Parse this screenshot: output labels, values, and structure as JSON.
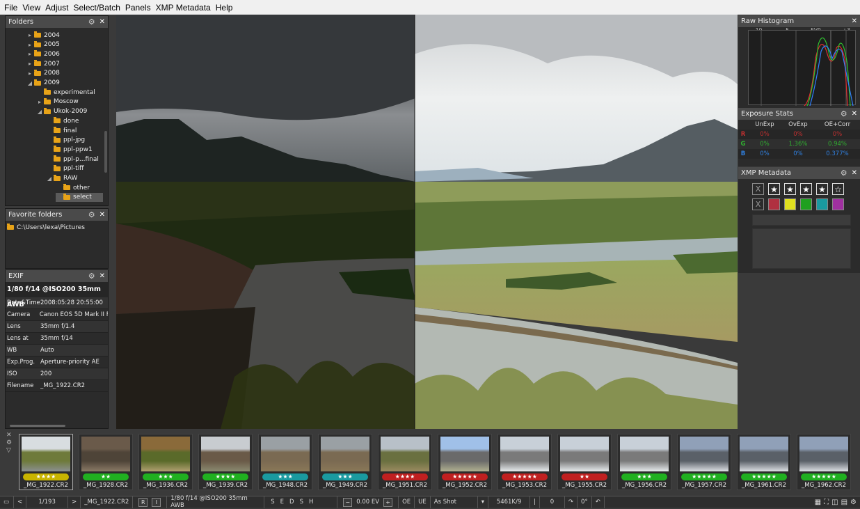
{
  "menu": [
    "File",
    "View",
    "Adjust",
    "Select/Batch",
    "Panels",
    "XMP Metadata",
    "Help"
  ],
  "folders": {
    "title": "Folders",
    "items": [
      {
        "label": "2004",
        "depth": 1,
        "arrow": "▸"
      },
      {
        "label": "2005",
        "depth": 1,
        "arrow": "▸"
      },
      {
        "label": "2006",
        "depth": 1,
        "arrow": "▸"
      },
      {
        "label": "2007",
        "depth": 1,
        "arrow": "▸"
      },
      {
        "label": "2008",
        "depth": 1,
        "arrow": "▸"
      },
      {
        "label": "2009",
        "depth": 1,
        "arrow": "◢"
      },
      {
        "label": "experimental",
        "depth": 2,
        "arrow": ""
      },
      {
        "label": "Moscow",
        "depth": 2,
        "arrow": "▸"
      },
      {
        "label": "Ukok-2009",
        "depth": 2,
        "arrow": "◢"
      },
      {
        "label": "done",
        "depth": 3,
        "arrow": ""
      },
      {
        "label": "final",
        "depth": 3,
        "arrow": ""
      },
      {
        "label": "ppl-jpg",
        "depth": 3,
        "arrow": ""
      },
      {
        "label": "ppl-ppw1",
        "depth": 3,
        "arrow": ""
      },
      {
        "label": "ppl-p...final",
        "depth": 3,
        "arrow": ""
      },
      {
        "label": "ppl-tiff",
        "depth": 3,
        "arrow": ""
      },
      {
        "label": "RAW",
        "depth": 3,
        "arrow": "◢"
      },
      {
        "label": "other",
        "depth": 4,
        "arrow": ""
      },
      {
        "label": "select",
        "depth": 4,
        "arrow": "",
        "selected": true
      }
    ]
  },
  "favorites": {
    "title": "Favorite folders",
    "items": [
      "C:\\Users\\lexa\\Pictures"
    ]
  },
  "exif": {
    "title": "EXIF",
    "summary": "1/80 f/14 @ISO200 35mm AWB",
    "rows": [
      {
        "k": "Date&Time",
        "v": "2008:05:28 20:55:00"
      },
      {
        "k": "Camera",
        "v": "Canon EOS 5D Mark II F"
      },
      {
        "k": "Lens",
        "v": "35mm f/1.4"
      },
      {
        "k": "Lens at",
        "v": "35mm f/14"
      },
      {
        "k": "WB",
        "v": "Auto"
      },
      {
        "k": "Exp.Prog.",
        "v": "Aperture-priority AE"
      },
      {
        "k": "ISO",
        "v": "200"
      },
      {
        "k": "Filename",
        "v": "_MG_1922.CR2"
      }
    ]
  },
  "histogram": {
    "title": "Raw Histogram",
    "ticks": [
      "-10",
      "-5",
      "EV0",
      "+3"
    ]
  },
  "exposure": {
    "title": "Exposure Stats",
    "cols": [
      "UnExp",
      "OvExp",
      "OE+Corr"
    ],
    "rows": [
      {
        "ch": "R",
        "color": "#c03030",
        "vals": [
          "0%",
          "0%",
          "0%"
        ]
      },
      {
        "ch": "G",
        "color": "#30b030",
        "vals": [
          "0%",
          "1.36%",
          "0.94%"
        ]
      },
      {
        "ch": "B",
        "color": "#3080e0",
        "vals": [
          "0%",
          "0%",
          "0.377%"
        ]
      }
    ]
  },
  "xmp": {
    "title": "XMP Metadata",
    "x_label": "X",
    "rating_stars": [
      "★",
      "★",
      "★",
      "★",
      "☆"
    ],
    "color_labels": [
      "#b03040",
      "#e0e020",
      "#20a020",
      "#1a9aa0",
      "#a030a0"
    ]
  },
  "filmstrip": [
    {
      "name": "_MG_1922.CR2",
      "stars": "★★★★",
      "color": "#c8b400",
      "scene": "a"
    },
    {
      "name": "_MG_1928.CR2",
      "stars": "★★",
      "color": "#20b020",
      "scene": "b"
    },
    {
      "name": "_MG_1936.CR2",
      "stars": "★★★",
      "color": "#20b020",
      "scene": "c"
    },
    {
      "name": "_MG_1939.CR2",
      "stars": "★★★★",
      "color": "#20b020",
      "scene": "d"
    },
    {
      "name": "_MG_1948.CR2",
      "stars": "★★★",
      "color": "#1a9aa0",
      "scene": "e"
    },
    {
      "name": "_MG_1949.CR2",
      "stars": "★★★",
      "color": "#1a9aa0",
      "scene": "e"
    },
    {
      "name": "_MG_1951.CR2",
      "stars": "★★★★",
      "color": "#c02020",
      "scene": "f"
    },
    {
      "name": "_MG_1952.CR2",
      "stars": "★★★★★",
      "color": "#c02020",
      "scene": "g"
    },
    {
      "name": "_MG_1953.CR2",
      "stars": "★★★★★",
      "color": "#c02020",
      "scene": "h"
    },
    {
      "name": "_MG_1955.CR2",
      "stars": "★★",
      "color": "#c02020",
      "scene": "h"
    },
    {
      "name": "_MG_1956.CR2",
      "stars": "★★★",
      "color": "#20b020",
      "scene": "h"
    },
    {
      "name": "_MG_1957.CR2",
      "stars": "★★★★★",
      "color": "#20b020",
      "scene": "i"
    },
    {
      "name": "_MG_1961.CR2",
      "stars": "★★★★★",
      "color": "#20b020",
      "scene": "i"
    },
    {
      "name": "_MG_1962.CR2",
      "stars": "★★★★★",
      "color": "#20b020",
      "scene": "i"
    }
  ],
  "status": {
    "counter": "1/193",
    "filename": "_MG_1922.CR2",
    "exif": "1/80 f/14 @ISO200 35mm AWB",
    "ev": "0.00 EV",
    "oe": "OE",
    "ue": "UE",
    "wb": "As Shot",
    "temp": "5461K/9",
    "rot": "0",
    "angle": "0°",
    "r": "R",
    "i": "I",
    "s_letter": "S",
    "e": "E",
    "d": "D",
    "h": "H"
  }
}
